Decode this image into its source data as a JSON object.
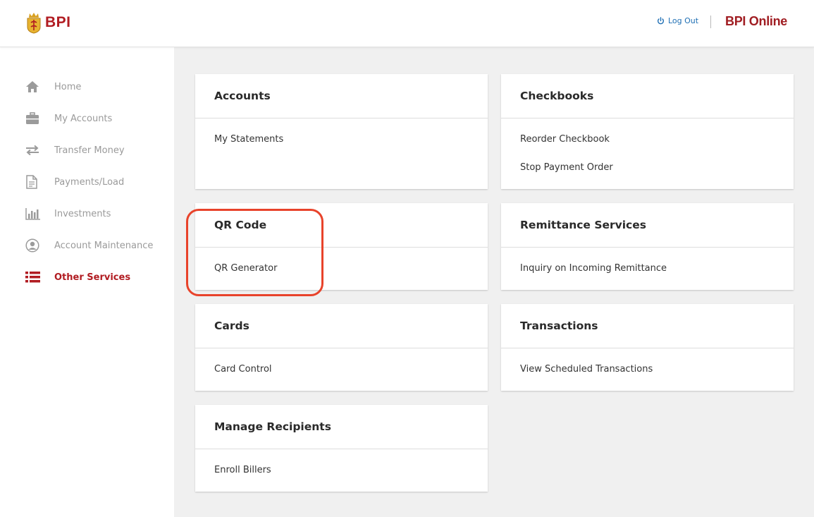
{
  "header": {
    "logo_text": "BPI",
    "logout_label": "Log Out",
    "brand": "BPI Online",
    "accent_color": "#b11c22",
    "link_color": "#1f6fb4"
  },
  "sidebar": {
    "items": [
      {
        "label": "Home",
        "icon": "home-icon",
        "active": false
      },
      {
        "label": "My Accounts",
        "icon": "briefcase-icon",
        "active": false
      },
      {
        "label": "Transfer Money",
        "icon": "transfer-arrows-icon",
        "active": false
      },
      {
        "label": "Payments/Load",
        "icon": "document-icon",
        "active": false
      },
      {
        "label": "Investments",
        "icon": "bar-chart-icon",
        "active": false
      },
      {
        "label": "Account Maintenance",
        "icon": "user-circle-icon",
        "active": false
      },
      {
        "label": "Other Services",
        "icon": "list-icon",
        "active": true
      }
    ]
  },
  "cards": {
    "accounts": {
      "title": "Accounts",
      "links": [
        "My Statements"
      ]
    },
    "checkbooks": {
      "title": "Checkbooks",
      "links": [
        "Reorder Checkbook",
        "Stop Payment Order"
      ]
    },
    "qr_code": {
      "title": "QR Code",
      "links": [
        "QR Generator"
      ]
    },
    "remittance": {
      "title": "Remittance Services",
      "links": [
        "Inquiry on Incoming Remittance"
      ]
    },
    "cards": {
      "title": "Cards",
      "links": [
        "Card Control"
      ]
    },
    "transactions": {
      "title": "Transactions",
      "links": [
        "View Scheduled Transactions"
      ]
    },
    "recipients": {
      "title": "Manage Recipients",
      "links": [
        "Enroll Billers"
      ]
    }
  },
  "annotation": {
    "color": "#e8432b"
  }
}
